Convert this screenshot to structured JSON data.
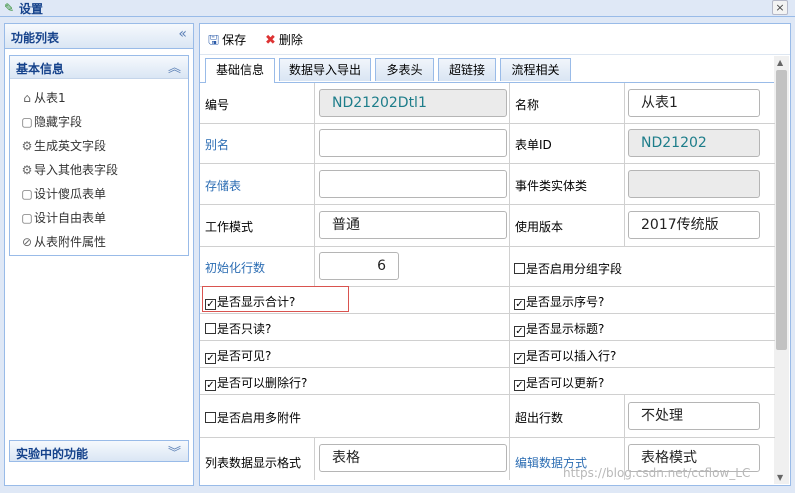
{
  "window": {
    "title": "设置",
    "close": "×"
  },
  "left": {
    "title": "功能列表",
    "collapse_icon": "«",
    "section": {
      "title": "基本信息",
      "icon": "︽"
    },
    "items": [
      {
        "label": "从表1",
        "icon": "home-icon",
        "glyph": "⌂"
      },
      {
        "label": "隐藏字段",
        "icon": "field-icon",
        "glyph": "▢"
      },
      {
        "label": "生成英文字段",
        "icon": "gear-icon",
        "glyph": "⚙"
      },
      {
        "label": "导入其他表字段",
        "icon": "gear-icon",
        "glyph": "⚙"
      },
      {
        "label": "设计傻瓜表单",
        "icon": "form-icon",
        "glyph": "▢"
      },
      {
        "label": "设计自由表单",
        "icon": "form-icon",
        "glyph": "▢"
      },
      {
        "label": "从表附件属性",
        "icon": "attachment-icon",
        "glyph": "⊘"
      }
    ],
    "bottom_section": {
      "title": "实验中的功能",
      "icon": "︾"
    }
  },
  "toolbar": {
    "save": "保存",
    "delete": "删除"
  },
  "tabs": [
    "基础信息",
    "数据导入导出",
    "多表头",
    "超链接",
    "流程相关"
  ],
  "form": {
    "no_label": "编号",
    "no_value": "ND21202Dtl1",
    "name_label": "名称",
    "name_value": "从表1",
    "alias_label": "别名",
    "alias_value": "",
    "formid_label": "表单ID",
    "formid_value": "ND21202",
    "storage_label": "存储表",
    "storage_value": "",
    "entity_label": "事件类实体类",
    "entity_value": "",
    "mode_label": "工作模式",
    "mode_value": "普通",
    "version_label": "使用版本",
    "version_value": "2017传统版",
    "initrows_label": "初始化行数",
    "initrows_value": "6",
    "grouping_label": "是否启用分组字段",
    "showsum_label": "是否显示合计?",
    "showseq_label": "是否显示序号?",
    "readonly_label": "是否只读?",
    "showtitle_label": "是否显示标题?",
    "visible_label": "是否可见?",
    "insert_label": "是否可以插入行?",
    "deleterow_label": "是否可以删除行?",
    "update_label": "是否可以更新?",
    "multiattach_label": "是否启用多附件",
    "overflow_label": "超出行数",
    "overflow_value": "不处理",
    "listfmt_label": "列表数据显示格式",
    "listfmt_value": "表格",
    "editmode_label": "编辑数据方式",
    "editmode_value": "表格模式"
  },
  "watermark": "https://blog.csdn.net/ccflow_LC"
}
